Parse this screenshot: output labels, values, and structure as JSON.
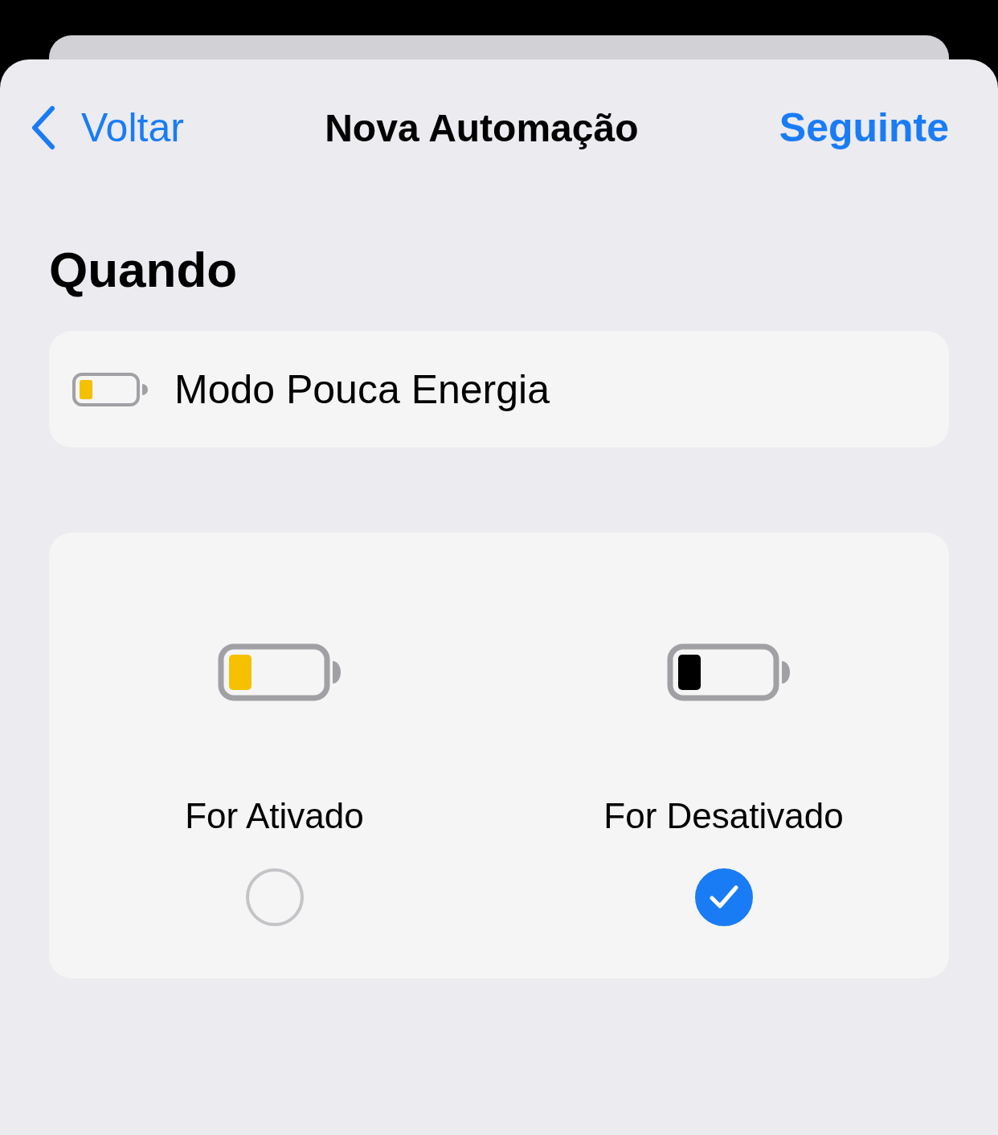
{
  "nav": {
    "back": "Voltar",
    "title": "Nova Automação",
    "next": "Seguinte"
  },
  "section_title": "Quando",
  "trigger": {
    "label": "Modo Pouca Energia"
  },
  "options": [
    {
      "label": "For Ativado",
      "selected": false,
      "color": "#f5c000"
    },
    {
      "label": "For Desativado",
      "selected": true,
      "color": "#000000"
    }
  ]
}
